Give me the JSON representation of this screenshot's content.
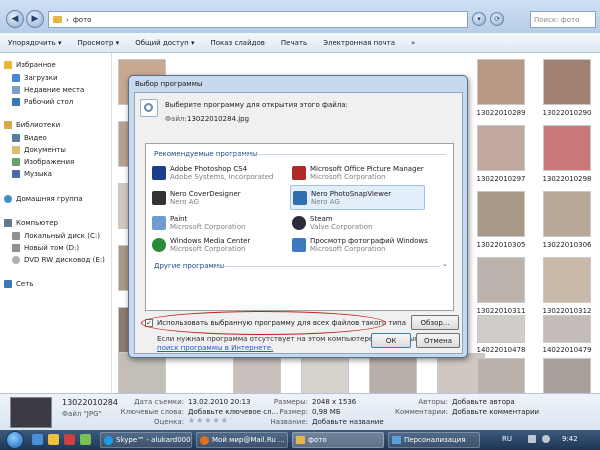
{
  "address": {
    "path_label": "фото",
    "search_placeholder": "Поиск: фото"
  },
  "toolbar": [
    "Упорядочить ▾",
    "Просмотр ▾",
    "Общий доступ ▾",
    "Показ слайдов",
    "Печать",
    "Электронная почта",
    "»"
  ],
  "sidebar": {
    "favorites": "Избранное",
    "favorites_items": [
      "Загрузки",
      "Недавние места",
      "Рабочий стол"
    ],
    "libraries": "Библиотеки",
    "libraries_items": [
      "Видео",
      "Документы",
      "Изображения",
      "Музыка"
    ],
    "homegroup": "Домашняя группа",
    "computer": "Компьютер",
    "computer_items": [
      "Локальный диск (C:)",
      "Новый том (D:)",
      "DVD RW дисковод (E:)"
    ],
    "network": "Сеть"
  },
  "thumbs": {
    "right_labels": [
      "13022010289",
      "13022010290",
      "13022010297",
      "13022010298",
      "13022010305",
      "13022010306",
      "13022010311",
      "13022010312",
      "14022010478",
      "14022010479"
    ]
  },
  "dialog": {
    "title": "Выбор программы",
    "prompt": "Выберите программу для открытия этого файла:",
    "file_label": "Файл:",
    "file_name": "13022010284.jpg",
    "recommended": "Рекомендуемые программы",
    "programs": [
      {
        "name": "Adobe Photoshop CS4",
        "corp": "Adobe Systems, Incorporated",
        "color": "#1b3f8e"
      },
      {
        "name": "Microsoft Office Picture Manager",
        "corp": "Microsoft Corporation",
        "color": "#b02a2a"
      },
      {
        "name": "Nero CoverDesigner",
        "corp": "Nero AG",
        "color": "#333333"
      },
      {
        "name": "Nero PhotoSnapViewer",
        "corp": "Nero AG",
        "color": "#2f6fb0"
      },
      {
        "name": "Paint",
        "corp": "Microsoft Corporation",
        "color": "#6f9bd1"
      },
      {
        "name": "Steam",
        "corp": "Valve Corporation",
        "color": "#2b2b3b"
      },
      {
        "name": "Windows Media Center",
        "corp": "Microsoft Corporation",
        "color": "#2a8a3a"
      },
      {
        "name": "Просмотр фотографий Windows",
        "corp": "Microsoft Corporation",
        "color": "#3d78c0"
      }
    ],
    "other": "Другие программы",
    "always_use": "Использовать выбранную программу для всех файлов такого типа",
    "browse": "Обзор...",
    "hint": "Если нужная программа отсутствует на этом компьютере, можно выполнить",
    "hint_link": "поиск программы в Интернете.",
    "ok": "ОК",
    "cancel": "Отмена"
  },
  "details": {
    "name": "13022010284",
    "type": "Файл \"JPG\"",
    "date_label": "Дата съемки:",
    "date": "13.02.2010 20:13",
    "keywords_label": "Ключевые слова:",
    "keywords": "Добавьте ключевое сл...",
    "rating_label": "Оценка:",
    "dims_label": "Размеры:",
    "dims": "2048 x 1536",
    "size_label": "Размер:",
    "size": "0,98 МБ",
    "title_label": "Название:",
    "title": "Добавьте название",
    "authors_label": "Авторы:",
    "authors": "Добавьте автора",
    "comments_label": "Комментарии:",
    "comments": "Добавьте комментарии"
  },
  "taskbar": {
    "buttons": [
      "Skype™ - alukard000",
      "Мой мир@Mail.Ru ...",
      "фото",
      "Персонализация"
    ],
    "lang": "RU",
    "clock": "9:42"
  }
}
